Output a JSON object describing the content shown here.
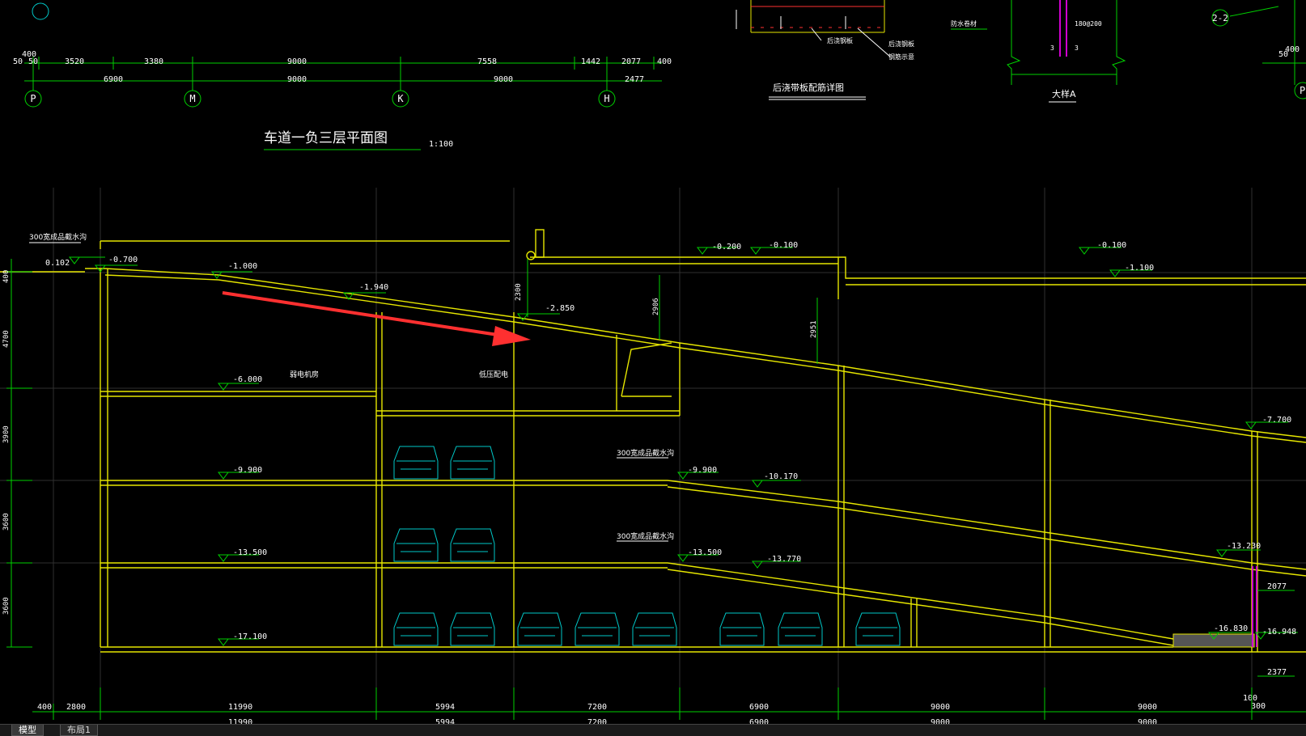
{
  "colors": {
    "background": "#000000",
    "outline": "#e6e600",
    "dim": "#00d000",
    "text": "#ffffff",
    "cyan": "#00c8c8",
    "red": "#ff3030",
    "magenta": "#d000d0"
  },
  "plan": {
    "title": "车道一负三层平面图",
    "scale": "1:100",
    "dims_top": [
      "400",
      "50",
      "50",
      "3520",
      "3380",
      "9000",
      "7558",
      "1442",
      "2077",
      "400"
    ],
    "dims_bottom": [
      "6900",
      "9000",
      "9000",
      "2477"
    ],
    "axes": [
      "P",
      "M",
      "K",
      "H"
    ],
    "right_dims": [
      "400",
      "50"
    ],
    "right_axis": "P",
    "section_tag": "2-2"
  },
  "details": {
    "rebar_title": "后浇带板配筋详图",
    "detail_a_title": "大样A",
    "small_notes": [
      "后浇钢板",
      "后浇钢板",
      "钢筋示意",
      "防水卷材",
      "180@200",
      "3",
      "3"
    ]
  },
  "section": {
    "levels": [
      {
        "id": "lv-0102",
        "label": "0.102"
      },
      {
        "id": "lv-0700",
        "label": "-0.700"
      },
      {
        "id": "lv-1000",
        "label": "-1.000"
      },
      {
        "id": "lv-1940",
        "label": "-1.940"
      },
      {
        "id": "lv-2850",
        "label": "-2.850"
      },
      {
        "id": "lv-0200",
        "label": "-0.200"
      },
      {
        "id": "lv-0100a",
        "label": "-0.100"
      },
      {
        "id": "lv-0100b",
        "label": "-0.100"
      },
      {
        "id": "lv-1100",
        "label": "-1.100"
      },
      {
        "id": "lv-6000",
        "label": "-6.000"
      },
      {
        "id": "lv-7700",
        "label": "-7.700"
      },
      {
        "id": "lv-9900a",
        "label": "-9.900"
      },
      {
        "id": "lv-9900b",
        "label": "-9.900"
      },
      {
        "id": "lv-10170",
        "label": "-10.170"
      },
      {
        "id": "lv-13500a",
        "label": "-13.500"
      },
      {
        "id": "lv-13500b",
        "label": "-13.500"
      },
      {
        "id": "lv-13770",
        "label": "-13.770"
      },
      {
        "id": "lv-13230",
        "label": "-13.230"
      },
      {
        "id": "lv-17100",
        "label": "-17.100"
      },
      {
        "id": "lv-16830",
        "label": "-16.830"
      },
      {
        "id": "lv-16948",
        "label": "-16.948"
      }
    ],
    "notes": [
      "300宽成品截水沟",
      "300宽成品截水沟",
      "300宽成品截水沟"
    ],
    "rooms": [
      "弱电机房",
      "低压配电"
    ],
    "vertical_dims": [
      "2300",
      "2906",
      "2951"
    ],
    "left_dims": [
      "400",
      "4700",
      "3900",
      "3600",
      "3600"
    ],
    "right_small_dims": [
      "2077",
      "2377",
      "100",
      "300"
    ],
    "bottom_dims": [
      "400",
      "2800",
      "11990",
      "5994",
      "7200",
      "6900",
      "9000",
      "9000"
    ],
    "bottom_dims_partial": [
      "11990",
      "5994",
      "7200",
      "6900",
      "9000",
      "9000"
    ]
  },
  "tabs": [
    {
      "label": "模型",
      "active": true
    },
    {
      "label": "布局1",
      "active": false
    }
  ]
}
